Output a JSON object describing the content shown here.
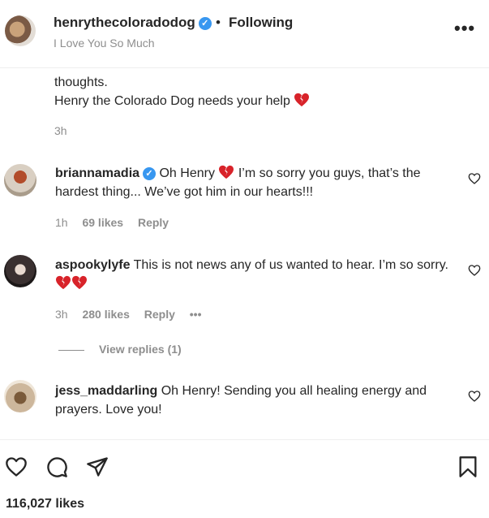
{
  "header": {
    "username": "henrythecoloradodog",
    "verified_mark": "✓",
    "separator": "•",
    "follow_label": "Following",
    "subtitle": "I Love You So Much",
    "more_label": "•••"
  },
  "caption": {
    "line1": "thoughts.",
    "line2": "Henry the Colorado Dog needs your help",
    "time": "3h"
  },
  "comments": [
    {
      "username": "briannamadia",
      "verified_mark": "✓",
      "text_a": "Oh Henry",
      "text_b": "I’m so sorry you guys, that’s the hardest thing... We’ve got him in our hearts!!!",
      "time": "1h",
      "likes": "69 likes",
      "reply": "Reply"
    },
    {
      "username": "aspookylyfe",
      "text_a": "This is not news any of us wanted to hear. I’m so sorry.",
      "time": "3h",
      "likes": "280 likes",
      "reply": "Reply",
      "more": "•••",
      "view_replies": "View replies (1)"
    },
    {
      "username": "jess_maddarling",
      "text_a": "Oh Henry! Sending you all healing energy and prayers. Love you!"
    }
  ],
  "footer": {
    "likes": "116,027 likes"
  },
  "icons": {
    "like": "heart-icon",
    "comment": "comment-bubble-icon",
    "share": "send-icon",
    "save": "bookmark-icon",
    "emoji": "broken-heart-emoji"
  },
  "colors": {
    "verified": "#3897f0",
    "secondary_text": "#8e8e8e",
    "broken_heart": "#d8232a"
  }
}
